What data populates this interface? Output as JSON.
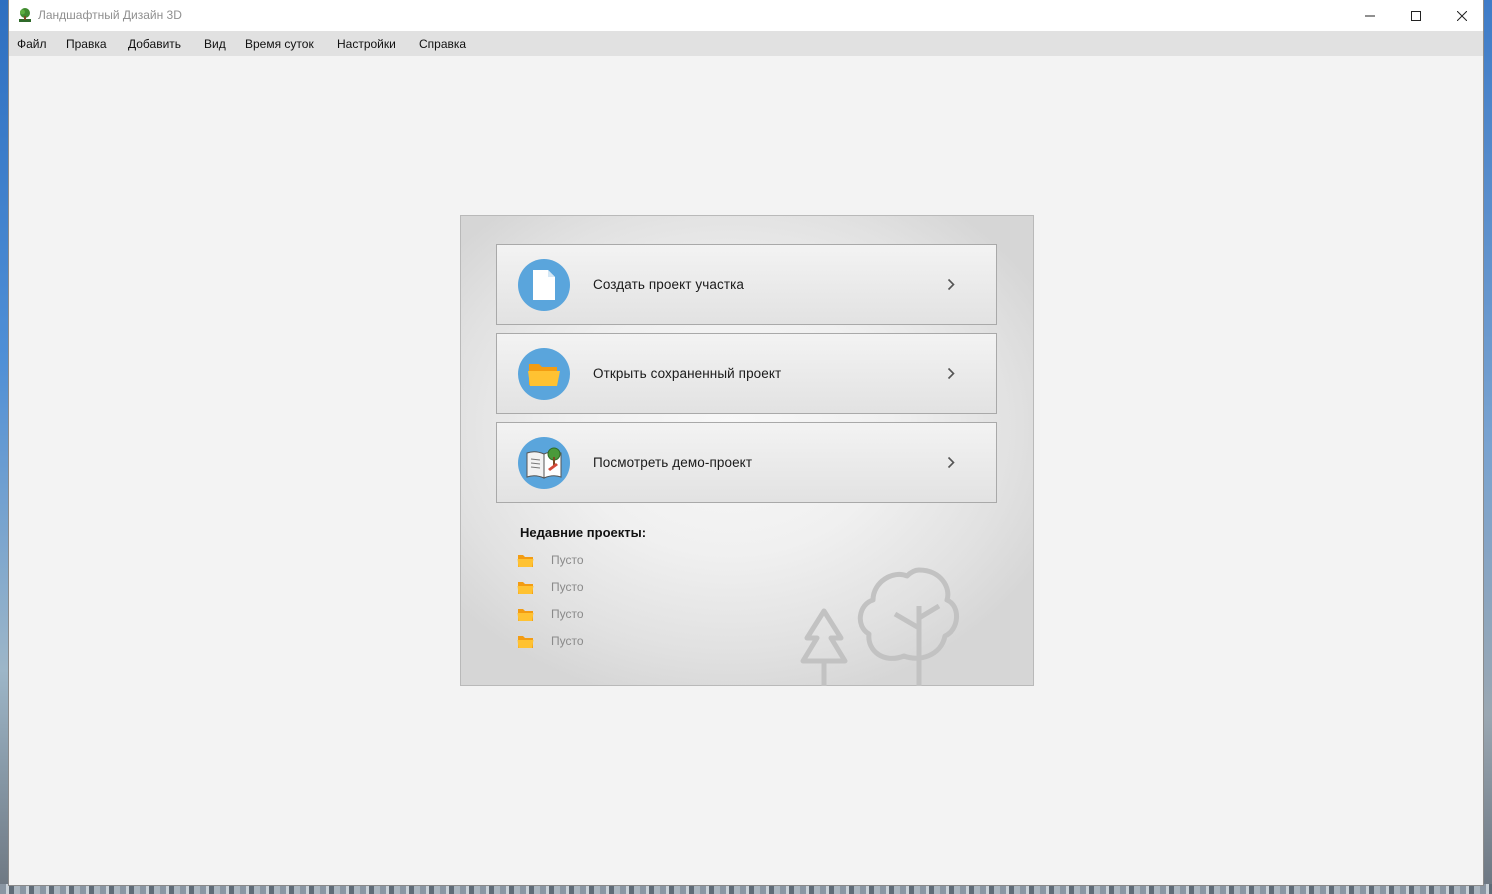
{
  "window": {
    "title": "Ландшафтный Дизайн 3D",
    "controls": [
      "minimize",
      "maximize",
      "close"
    ]
  },
  "menu": [
    "Файл",
    "Правка",
    "Добавить",
    "Вид",
    "Время суток",
    "Настройки",
    "Справка"
  ],
  "actions": [
    {
      "label": "Создать проект участка",
      "icon": "document-icon"
    },
    {
      "label": "Открыть сохраненный проект",
      "icon": "folder-icon"
    },
    {
      "label": "Посмотреть демо-проект",
      "icon": "demo-book-icon"
    }
  ],
  "recent": {
    "title": "Недавние проекты:",
    "items": [
      "Пусто",
      "Пусто",
      "Пусто",
      "Пусто"
    ]
  },
  "colors": {
    "accent_circle": "#5aa5dc",
    "folder": "#fbb21f",
    "window_bg": "#f3f3f3",
    "menubar_bg": "#e1e1e1"
  }
}
